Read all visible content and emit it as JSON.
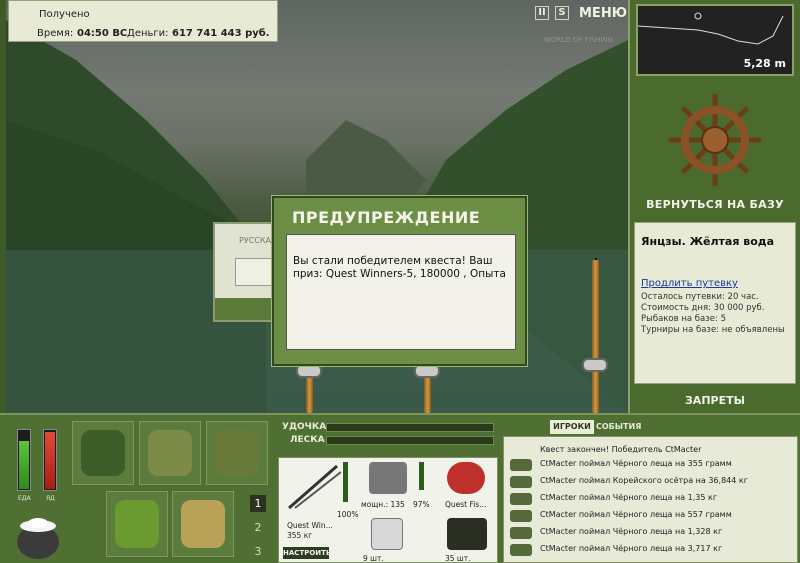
{
  "hud": {
    "received_label": "Получено",
    "time_label": "Время:",
    "time_value": "04:50 ВС",
    "money_label": "Деньги:",
    "money_value": "617 741 443 руб.",
    "pause_icon": "II",
    "s_icon": "S",
    "menu_label": "МЕНЮ",
    "watermark": "WORLD OF FISHING"
  },
  "depth": {
    "value": "5,28 m"
  },
  "right_panel": {
    "return_label": "ВЕРНУТЬСЯ НА БАЗУ",
    "location_title": "Янцзы. Жёлтая вода",
    "extend_link": "Продлить путевку",
    "lines": [
      "Осталось путевки: 20 час.",
      "Стоимость дня: 30 000 руб.",
      "Рыбаков на базе: 5",
      "Турниры на базе: не объявлены"
    ],
    "bans_label": "ЗАПРЕТЫ"
  },
  "background_dialog": {
    "label": "РУССКАЯ"
  },
  "warning": {
    "title": "ПРЕДУПРЕЖДЕНИЕ",
    "message": "Вы стали победителем квеста! Ваш приз: Quest Winners-5, 180000 , Опыта"
  },
  "status": {
    "food_label": "ЕДА",
    "poison_label": "ЯД",
    "food_level": 0.8,
    "poison_level": 0.95
  },
  "slots": {
    "page_buttons": [
      "1",
      "2",
      "3"
    ]
  },
  "rod": {
    "rod_label": "УДОЧКА",
    "line_label": "ЛЕСКА",
    "rod_name": "Quest Win...",
    "rod_weight": "355 кг",
    "durability": "100%",
    "reel_power": "мощн.: 135",
    "reel_pct": "97%",
    "bait_name": "Quest Fis...",
    "hooks_count": "9 шт.",
    "lure_count": "35 шт.",
    "setup_label": "НАСТРОИТЬ"
  },
  "chat": {
    "tab_players": "ИГРОКИ",
    "tab_events": "СОБЫТИЯ",
    "header": "Квест закончен! Победитель CtMacter",
    "messages": [
      "CtMacter поймал Чёрного леща на 355 грамм",
      "CtMacter поймал Корейского осётра на 36,844 кг",
      "CtMacter поймал Чёрного леща на 1,35 кг",
      "CtMacter поймал Чёрного леща на 557 грамм",
      "CtMacter поймал Чёрного леща на 1,328 кг",
      "CtMacter поймал Чёрного леща на 3,717 кг"
    ]
  }
}
